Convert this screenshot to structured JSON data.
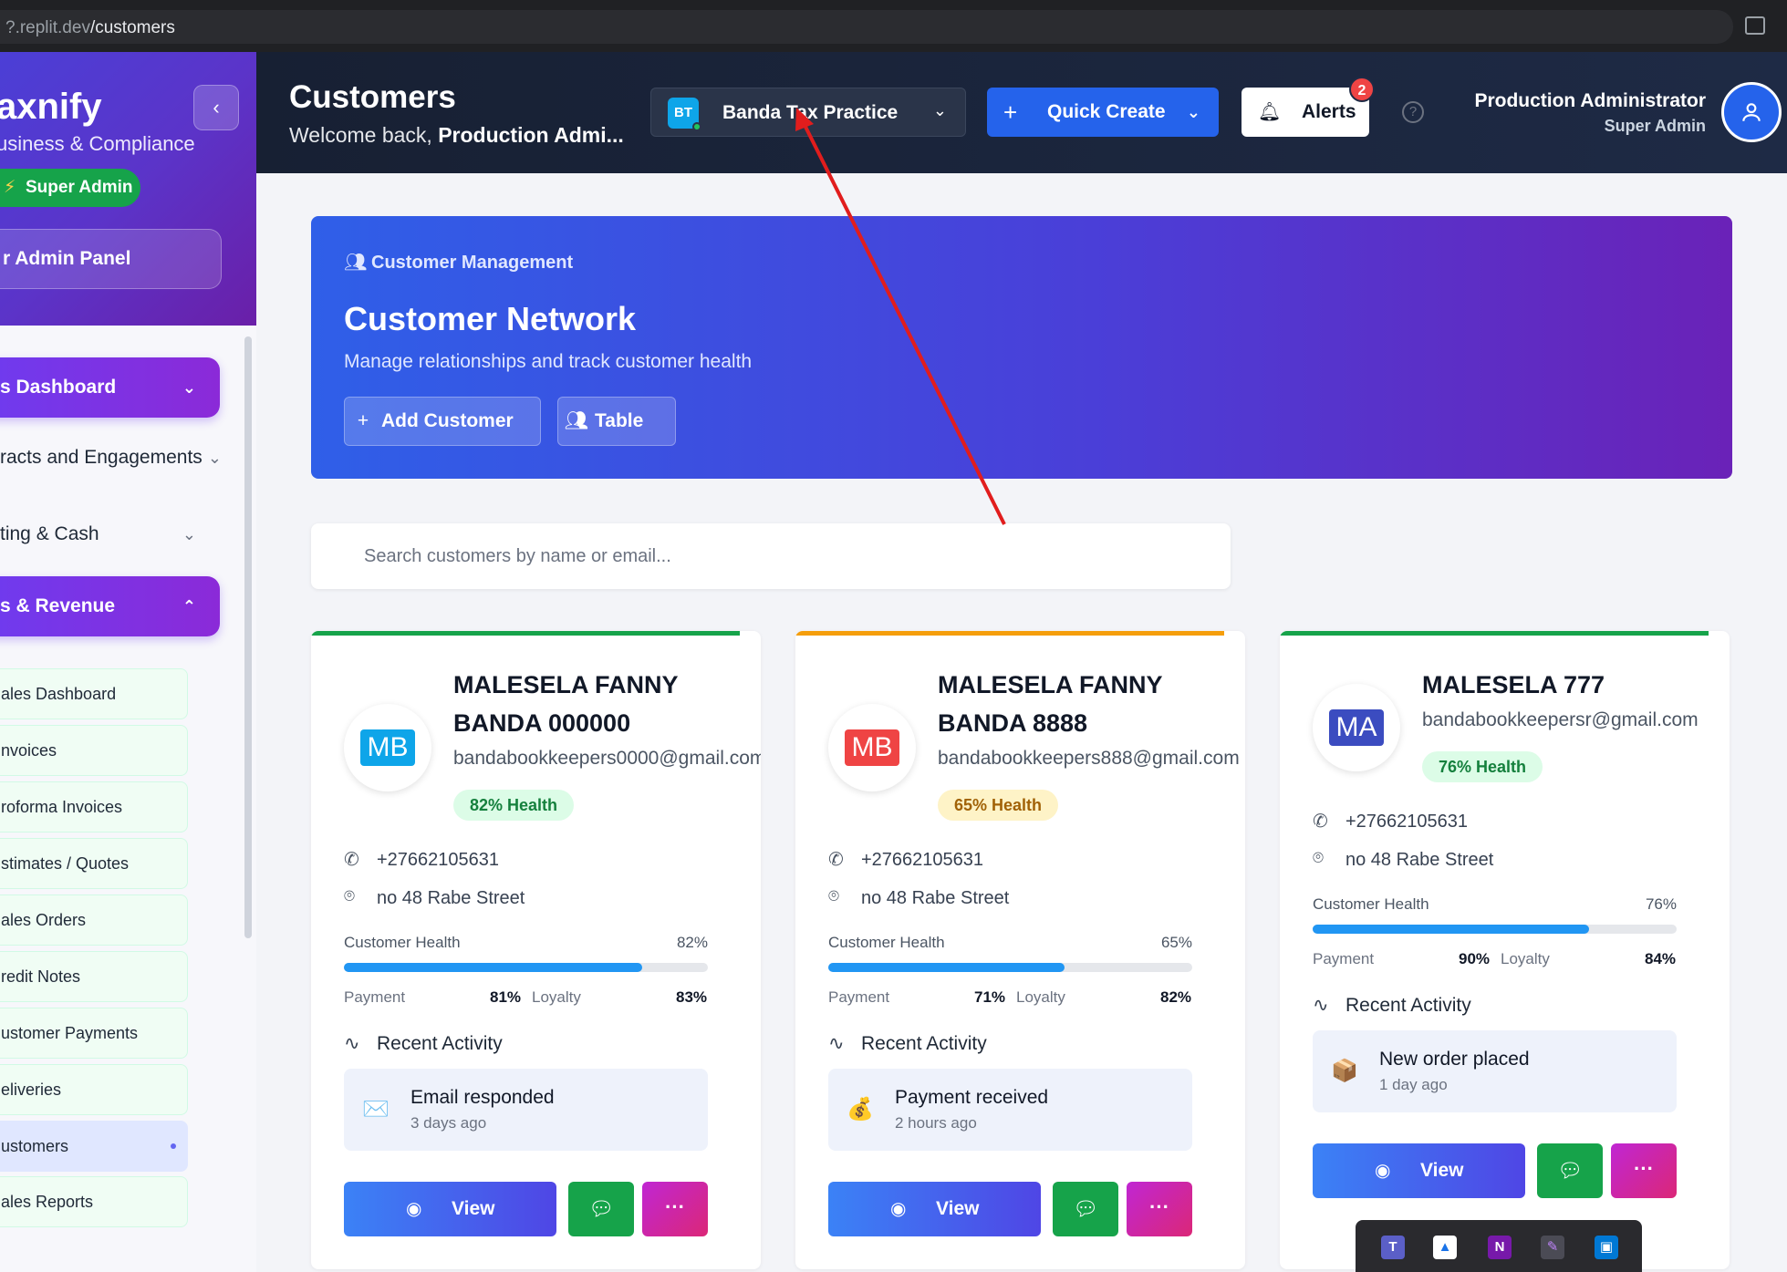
{
  "browser": {
    "url_prefix": "?.replit.dev",
    "url_path": "/customers"
  },
  "sidebar": {
    "brand": "axnify",
    "brand_sub": "usiness & Compliance",
    "role_badge": "Super Admin",
    "admin_panel": "r Admin Panel",
    "collapse_icon": "‹",
    "sections": [
      {
        "label": "s Dashboard",
        "chevron": "⌄"
      },
      {
        "label": "racts and Engagements",
        "chevron": "⌄"
      },
      {
        "label": "ting & Cash",
        "chevron": "⌄"
      },
      {
        "label": "s & Revenue",
        "chevron": "⌃"
      }
    ],
    "sub_items": [
      {
        "label": "ales Dashboard"
      },
      {
        "label": "nvoices"
      },
      {
        "label": "roforma Invoices"
      },
      {
        "label": "stimates / Quotes"
      },
      {
        "label": "ales Orders"
      },
      {
        "label": "redit Notes"
      },
      {
        "label": "ustomer Payments"
      },
      {
        "label": "eliveries"
      },
      {
        "label": "ustomers"
      },
      {
        "label": "ales Reports"
      }
    ]
  },
  "header": {
    "title": "Customers",
    "welcome_prefix": "Welcome back, ",
    "welcome_name": "Production Admi...",
    "practice_initials": "BT",
    "practice_name": "Banda Tax Practice",
    "quick_create": "Quick Create",
    "alerts": "Alerts",
    "alerts_count": "2",
    "help": "?",
    "user_name": "Production Administrator",
    "user_role": "Super Admin"
  },
  "hero": {
    "kicker": "Customer Management",
    "title": "Customer Network",
    "subtitle": "Manage relationships and track customer health",
    "add_button": "Add Customer",
    "table_button": "Table"
  },
  "search": {
    "placeholder": "Search customers by name or email..."
  },
  "cards": [
    {
      "initials": "MB",
      "name": "MALESELA FANNY BANDA 000000",
      "email": "bandabookkeepers0000@gmail.com",
      "health_badge": "82% Health",
      "phone": "+27662105631",
      "address": "no 48 Rabe Street",
      "health_label": "Customer Health",
      "health_pct": "82%",
      "health_value": 0.82,
      "payment_label": "Payment",
      "payment": "81%",
      "loyalty_label": "Loyalty",
      "loyalty": "83%",
      "activity_title": "Recent Activity",
      "activity_emoji": "✉️",
      "activity": "Email responded",
      "activity_time": "3 days ago",
      "view": "View",
      "more": "···",
      "accent": "#16a34a",
      "avatar_color": "#0ea5e9"
    },
    {
      "initials": "MB",
      "name": "MALESELA FANNY BANDA 8888",
      "email": "bandabookkeepers888@gmail.com",
      "health_badge": "65% Health",
      "phone": "+27662105631",
      "address": "no 48 Rabe Street",
      "health_label": "Customer Health",
      "health_pct": "65%",
      "health_value": 0.65,
      "payment_label": "Payment",
      "payment": "71%",
      "loyalty_label": "Loyalty",
      "loyalty": "82%",
      "activity_title": "Recent Activity",
      "activity_emoji": "💰",
      "activity": "Payment received",
      "activity_time": "2 hours ago",
      "view": "View",
      "more": "···",
      "accent": "#f59e0b",
      "avatar_color": "#ef4444"
    },
    {
      "initials": "MA",
      "name": "MALESELA 777",
      "email": "bandabookkeepersr@gmail.com",
      "health_badge": "76% Health",
      "phone": "+27662105631",
      "address": "no 48 Rabe Street",
      "health_label": "Customer Health",
      "health_pct": "76%",
      "health_value": 0.76,
      "payment_label": "Payment",
      "payment": "90%",
      "loyalty_label": "Loyalty",
      "loyalty": "84%",
      "activity_title": "Recent Activity",
      "activity_emoji": "📦",
      "activity": "New order placed",
      "activity_time": "1 day ago",
      "view": "View",
      "more": "···",
      "accent": "#16a34a",
      "avatar_color": "#3b4cc0"
    }
  ],
  "taskbar": {
    "apps": [
      {
        "icon": "teams-icon"
      },
      {
        "icon": "drive-icon"
      },
      {
        "icon": "onenote-icon"
      },
      {
        "icon": "pen-icon"
      },
      {
        "icon": "store-icon"
      }
    ]
  },
  "colors": {
    "badge_green_bg": "#dcfce7",
    "badge_green_fg": "#15803d",
    "badge_yellow_bg": "#fef3c7",
    "badge_yellow_fg": "#a16207",
    "annotation_arrow": "#e11d1d"
  }
}
